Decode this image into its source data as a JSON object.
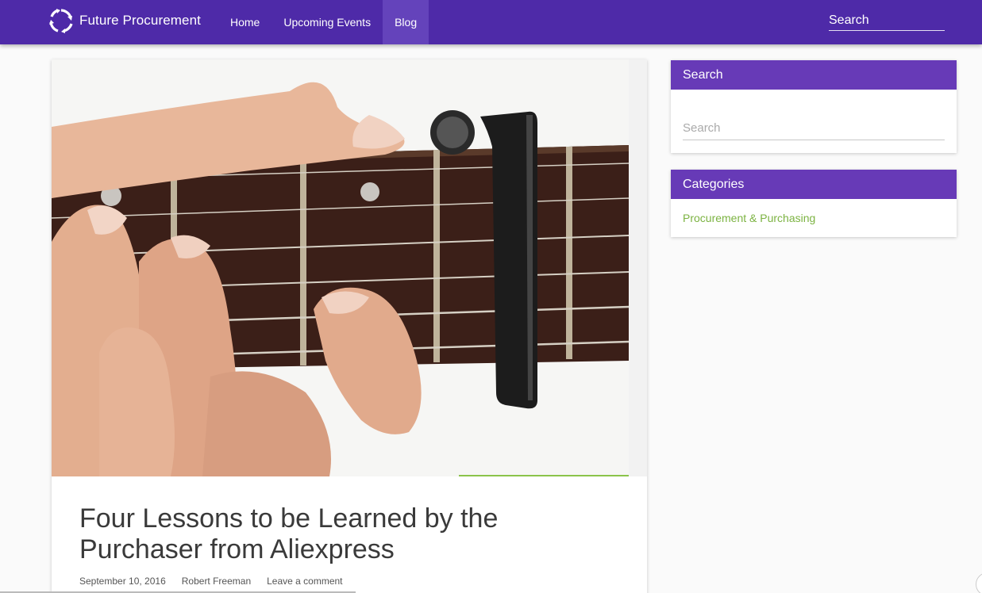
{
  "navbar": {
    "brand": "Future Procurement",
    "brand_icon": "rotating-arrows-logo",
    "items": [
      {
        "label": "Home",
        "active": false
      },
      {
        "label": "Upcoming Events",
        "active": false
      },
      {
        "label": "Blog",
        "active": true
      }
    ],
    "search_placeholder": "Search"
  },
  "post": {
    "image": "hand-with-guitar-capo-photo",
    "title": "Four Lessons to be Learned by the Purchaser from Aliexpress",
    "meta": {
      "date": "September 10, 2016",
      "author": "Robert Freeman",
      "comments": "Leave a comment"
    }
  },
  "sidebar": {
    "search": {
      "title": "Search",
      "placeholder": "Search"
    },
    "categories": {
      "title": "Categories",
      "items": [
        "Procurement & Purchasing"
      ]
    }
  },
  "colors": {
    "navbar": "#4e2aa8",
    "nav_active": "#6443bb",
    "widget_header": "#673ab7",
    "link_green": "#7cb342"
  }
}
